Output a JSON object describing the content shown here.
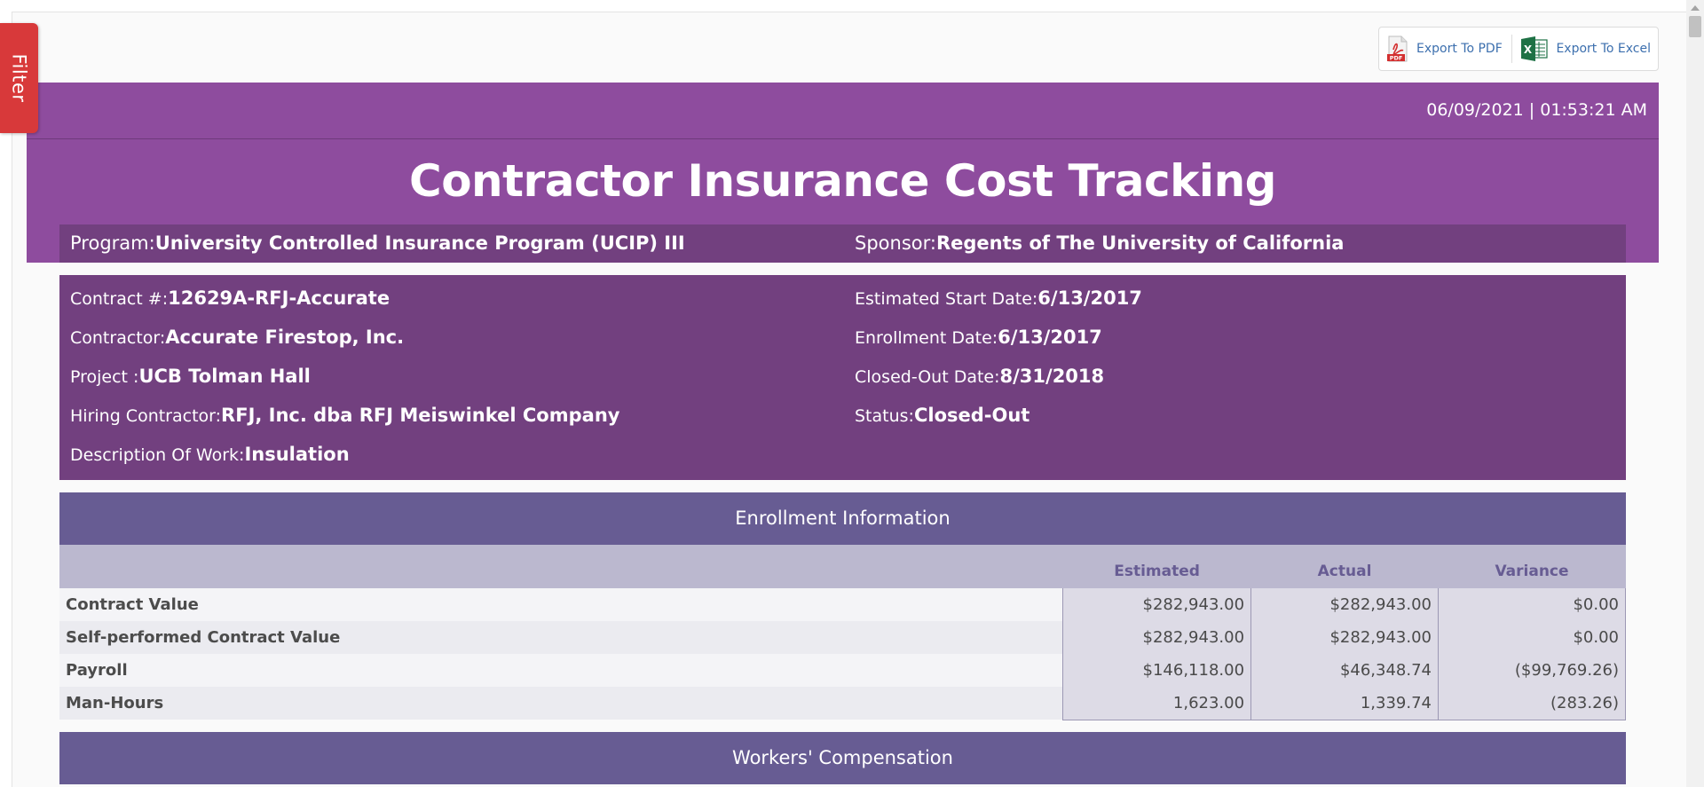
{
  "filter": {
    "label": "Filter"
  },
  "export": {
    "pdf_label": "Export To PDF",
    "excel_label": "Export To Excel",
    "pdf_badge": "PDF",
    "excel_badge": "X"
  },
  "header": {
    "timestamp": "06/09/2021 | 01:53:21 AM",
    "title": "Contractor Insurance Cost Tracking"
  },
  "program_bar": {
    "program_label": "Program:",
    "program_value": "University Controlled Insurance Program (UCIP) III",
    "sponsor_label": "Sponsor:",
    "sponsor_value": "Regents of The University of California"
  },
  "details": {
    "contract_label": "Contract #:",
    "contract_value": "12629A-RFJ-Accurate",
    "contractor_label": "Contractor:",
    "contractor_value": "Accurate Firestop, Inc.",
    "project_label": "Project :",
    "project_value": "UCB Tolman Hall",
    "hiring_label": "Hiring Contractor:",
    "hiring_value": "RFJ, Inc. dba RFJ Meiswinkel Company",
    "description_label": "Description Of Work:",
    "description_value": "Insulation",
    "start_label": "Estimated Start Date:",
    "start_value": "6/13/2017",
    "enrollment_label": "Enrollment Date:",
    "enrollment_value": "6/13/2017",
    "closed_label": "Closed-Out Date:",
    "closed_value": "8/31/2018",
    "status_label": "Status:",
    "status_value": "Closed-Out"
  },
  "enrollment": {
    "section_title": "Enrollment Information",
    "columns": [
      "",
      "Estimated",
      "Actual",
      "Variance"
    ],
    "rows": [
      {
        "label": "Contract Value",
        "estimated": "$282,943.00",
        "actual": "$282,943.00",
        "variance": "$0.00"
      },
      {
        "label": "Self-performed Contract Value",
        "estimated": "$282,943.00",
        "actual": "$282,943.00",
        "variance": "$0.00"
      },
      {
        "label": "Payroll",
        "estimated": "$146,118.00",
        "actual": "$46,348.74",
        "variance": "($99,769.26)"
      },
      {
        "label": "Man-Hours",
        "estimated": "1,623.00",
        "actual": "1,339.74",
        "variance": "(283.26)"
      }
    ]
  },
  "workers_comp": {
    "section_title": "Workers' Compensation"
  },
  "colors": {
    "header_purple": "#8e4c9e",
    "dark_purple": "#72407f",
    "section_purple": "#675c93",
    "filter_red": "#d8393a"
  }
}
